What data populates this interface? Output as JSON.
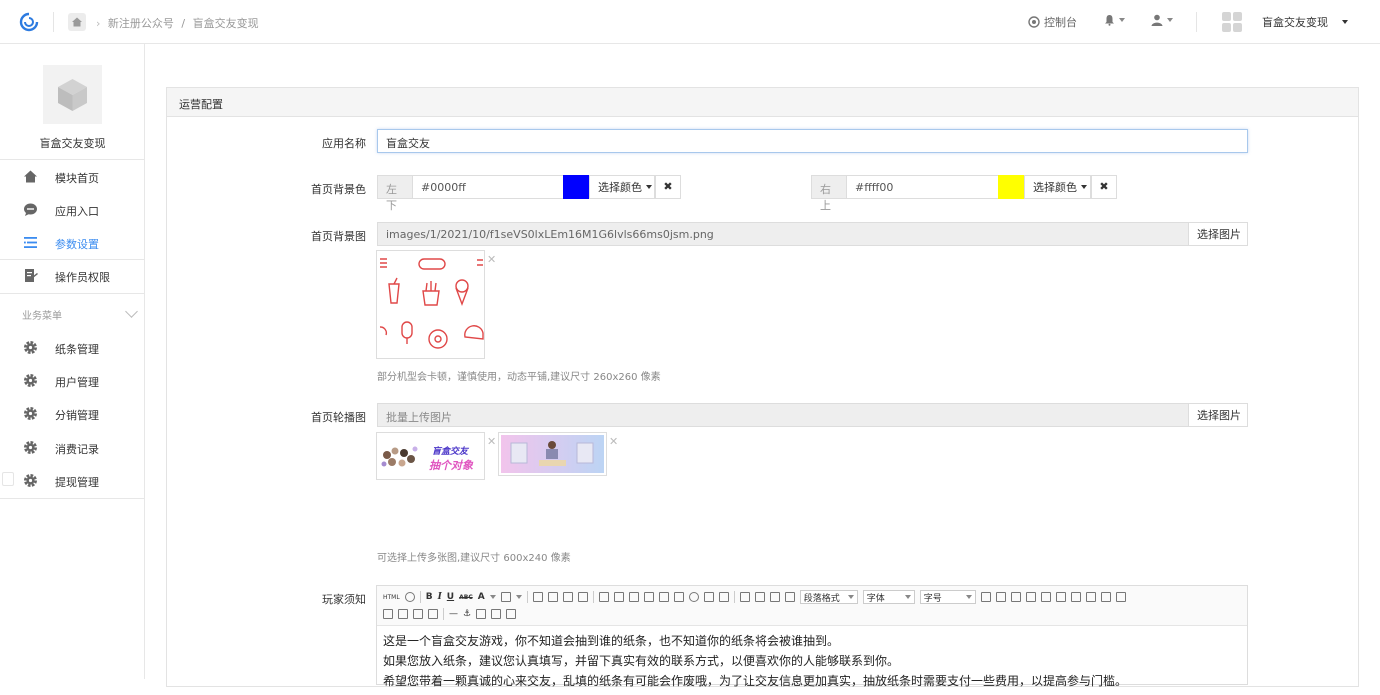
{
  "topbar": {
    "breadcrumb": [
      "新注册公众号",
      "/",
      "盲盒交友变现"
    ],
    "console_label": "控制台",
    "account_name": "盲盒交友变现"
  },
  "sidebar": {
    "app_title": "盲盒交友变现",
    "items": [
      {
        "label": "模块首页",
        "icon": "home-icon"
      },
      {
        "label": "应用入口",
        "icon": "chat-icon"
      },
      {
        "label": "参数设置",
        "icon": "list-icon",
        "active": true
      },
      {
        "label": "操作员权限",
        "icon": "user-edit-icon"
      }
    ],
    "group_label": "业务菜单",
    "group_items": [
      {
        "label": "纸条管理",
        "icon": "gear-icon"
      },
      {
        "label": "用户管理",
        "icon": "gear-icon"
      },
      {
        "label": "分销管理",
        "icon": "gear-icon"
      },
      {
        "label": "消费记录",
        "icon": "gear-icon"
      },
      {
        "label": "提现管理",
        "icon": "gear-icon"
      }
    ]
  },
  "panel": {
    "title": "运营配置"
  },
  "form": {
    "app_name": {
      "label": "应用名称",
      "value": "盲盒交友"
    },
    "bg_color": {
      "label": "首页背景色",
      "left": {
        "addon": "左下",
        "value": "#0000ff",
        "color": "#0000ff",
        "pick_label": "选择颜色"
      },
      "right": {
        "addon": "右上",
        "value": "#ffff00",
        "color": "#ffff00",
        "pick_label": "选择颜色"
      }
    },
    "bg_image": {
      "label": "首页背景图",
      "value": "images/1/2021/10/f1seVS0lxLEm16M1G6lvls66ms0jsm.png",
      "pick_label": "选择图片",
      "hint": "部分机型会卡顿，谨慎使用，动态平铺,建议尺寸 260x260 像素"
    },
    "carousel": {
      "label": "首页轮播图",
      "placeholder": "批量上传图片",
      "pick_label": "选择图片",
      "image1_text": [
        "盲盒交友",
        "抽个对象"
      ],
      "hint": "可选择上传多张图,建议尺寸 600x240 像素"
    },
    "notice": {
      "label": "玩家须知",
      "toolbar": {
        "html": "HTML",
        "bold": "B",
        "italic": "I",
        "underline": "U",
        "strike": "ABC",
        "font_color": "A",
        "paragraph": "段落格式",
        "font_family": "字体",
        "font_size": "字号"
      },
      "lines": [
        "这是一个盲盒交友游戏，你不知道会抽到谁的纸条，也不知道你的纸条将会被谁抽到。",
        "如果您放入纸条，建议您认真填写，并留下真实有效的联系方式，以便喜欢你的人能够联系到你。",
        "希望您带着一颗真诚的心来交友，乱填的纸条有可能会作废哦，为了让交友信息更加真实，抽放纸条时需要支付一些费用，以提高参与门槛。"
      ]
    }
  }
}
